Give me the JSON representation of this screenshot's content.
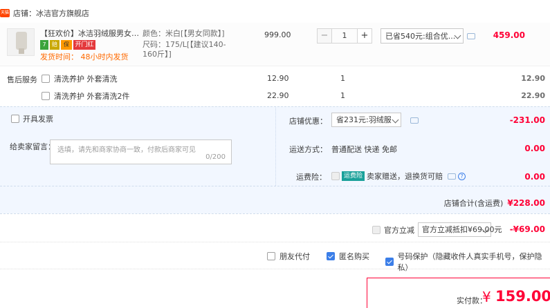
{
  "shop": {
    "icon_text": "天猫",
    "label": "店铺：冰洁官方旗舰店"
  },
  "item": {
    "title": "【狂欢价】冰洁羽绒服男女同款...",
    "badges": [
      "7",
      "赔",
      "保"
    ],
    "badge_red": "开门红",
    "ship_note": "发货时间： 48小时内发货",
    "attr1": "颜色：米白[【男女同款】]",
    "attr2": "尺码：175/L[【建议140-160斤】]",
    "price": "999.00",
    "qty": "1",
    "qty_minus": "−",
    "qty_plus": "+",
    "promo": "已省540元:组合优...",
    "total": "459.00"
  },
  "services": {
    "label": "售后服务",
    "rows": [
      {
        "name": "清洗养护 外套清洗",
        "price": "12.90",
        "qty": "1",
        "total": "12.90"
      },
      {
        "name": "清洗养护 外套清洗2件",
        "price": "22.90",
        "qty": "1",
        "total": "22.90"
      }
    ]
  },
  "invoice": {
    "label": "开具发票"
  },
  "message": {
    "label": "给卖家留言：",
    "placeholder": "选填，请先和商家协商一致，付款后商家可见",
    "count": "0/200"
  },
  "store_discount": {
    "label": "店铺优惠：",
    "select": "省231元:羽绒服",
    "value": "-231.00"
  },
  "shipping": {
    "label": "运送方式：",
    "method": "普通配送 快递 免邮",
    "value": "0.00"
  },
  "insurance": {
    "label": "运费险：",
    "tag": "运费险",
    "text": "卖家赠送，退换货可赔",
    "value": "0.00"
  },
  "subtotal": {
    "label": "店铺合计(含运费)",
    "value": "¥228.00"
  },
  "official": {
    "label": "官方立减",
    "select": "官方立减抵扣¥69.00元",
    "value": "-¥69.00"
  },
  "options": {
    "friend_pay": "朋友代付",
    "anon": "匿名购买",
    "phone_protect": "号码保护（隐藏收件人真实手机号，保护隐私）"
  },
  "pay": {
    "label": "实付款：",
    "currency": "¥",
    "amount": "159.00"
  },
  "colors": {
    "accent": "#ff0036",
    "panel": "#f2f7ff",
    "check": "#3b7ee8"
  }
}
